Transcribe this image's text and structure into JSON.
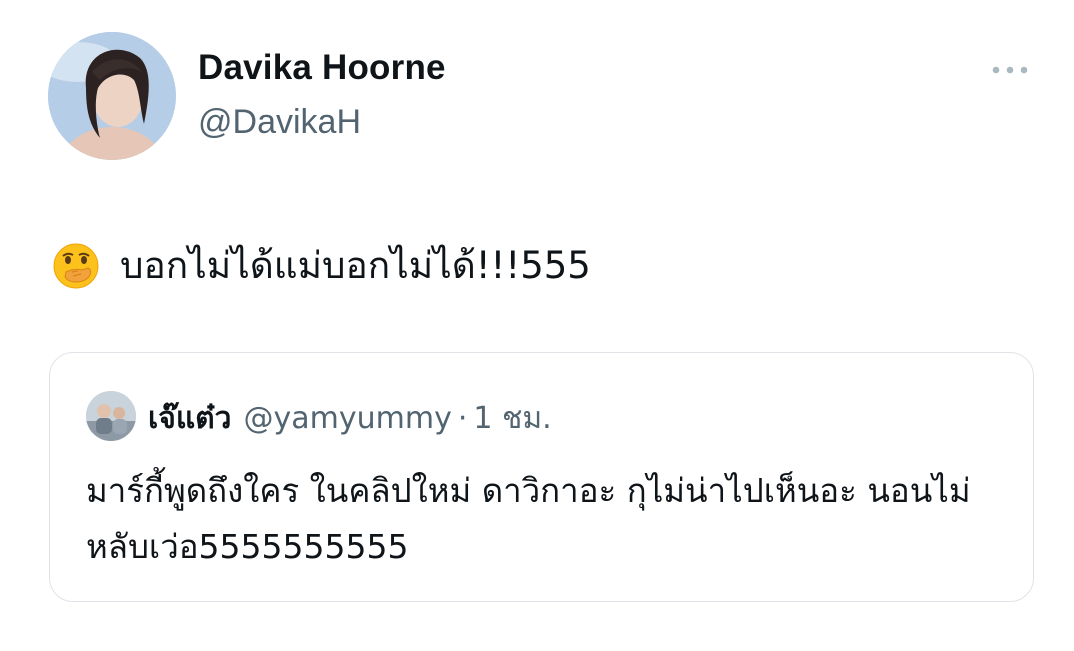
{
  "author": {
    "display_name": "Davika Hoorne",
    "handle": "@DavikaH"
  },
  "tweet": {
    "emoji": "face-with-hand-over-mouth",
    "text": "บอกไม่ได้แม่บอกไม่ได้!!!555"
  },
  "quoted_tweet": {
    "display_name": "เจ๊แต๋ว",
    "handle": "@yamyummy",
    "separator": "·",
    "time": "1 ชม.",
    "text": "มาร์กี้พูดถึงใคร ในคลิปใหม่ ดาวิกาอะ กุไม่น่าไปเห็นอะ นอนไม่หลับเว่อ5555555555"
  },
  "icons": {
    "more": "more-horizontal-icon"
  },
  "colors": {
    "text_primary": "#0f1419",
    "text_secondary": "#536471",
    "card_border": "#dfe3e7",
    "icon_gray": "#aab8c2"
  }
}
